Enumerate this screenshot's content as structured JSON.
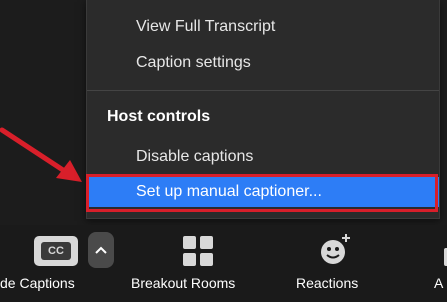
{
  "menu": {
    "items_top": [
      {
        "label": "View Full Transcript"
      },
      {
        "label": "Caption settings"
      }
    ],
    "section_heading": "Host controls",
    "items_host": [
      {
        "label": "Disable captions"
      },
      {
        "label": "Set up manual captioner..."
      }
    ],
    "highlighted_item": "Set up manual captioner...",
    "highlight_color": "#2d7df6",
    "annotation_color": "#d81f2a"
  },
  "toolbar": {
    "captions": {
      "icon_text": "CC",
      "label": "de Captions",
      "icon": "closed-caption-icon"
    },
    "caret": {
      "icon": "chevron-up-icon"
    },
    "breakout": {
      "label": "Breakout Rooms",
      "icon": "breakout-rooms-icon"
    },
    "reactions": {
      "label": "Reactions",
      "icon": "add-reaction-icon"
    },
    "apps": {
      "label": "A",
      "icon": "apps-icon"
    }
  }
}
